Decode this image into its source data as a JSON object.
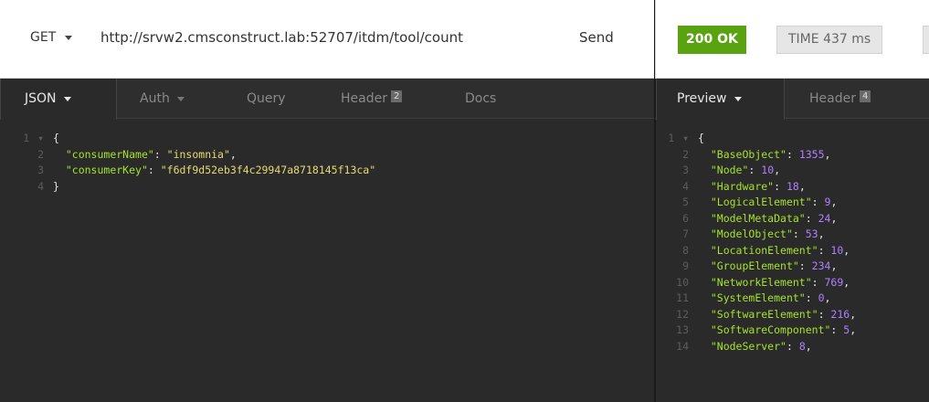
{
  "request": {
    "method": "GET",
    "url": "http://srvw2.cmsconstruct.lab:52707/itdm/tool/count",
    "send_label": "Send"
  },
  "response": {
    "status": "200 OK",
    "time_label": "TIME",
    "time_value": "437 ms"
  },
  "left_tabs": [
    {
      "label": "JSON",
      "active": true
    },
    {
      "label": "Auth"
    },
    {
      "label": "Query"
    },
    {
      "label": "Header",
      "badge": "2"
    },
    {
      "label": "Docs"
    }
  ],
  "right_tabs": [
    {
      "label": "Preview",
      "active": true
    },
    {
      "label": "Header",
      "badge": "4"
    }
  ],
  "request_body": [
    {
      "n": "1",
      "fold": true,
      "text": "{"
    },
    {
      "n": "2",
      "key": "consumerName",
      "str": "insomnia",
      "comma": true
    },
    {
      "n": "3",
      "key": "consumerKey",
      "str": "f6df9d52eb3f4c29947a8718145f13ca"
    },
    {
      "n": "4",
      "text": "}"
    }
  ],
  "response_body": [
    {
      "n": "1",
      "fold": true,
      "text": "{"
    },
    {
      "n": "2",
      "key": "BaseObject",
      "num": "1355"
    },
    {
      "n": "3",
      "key": "Node",
      "num": "10"
    },
    {
      "n": "4",
      "key": "Hardware",
      "num": "18"
    },
    {
      "n": "5",
      "key": "LogicalElement",
      "num": "9"
    },
    {
      "n": "6",
      "key": "ModelMetaData",
      "num": "24"
    },
    {
      "n": "7",
      "key": "ModelObject",
      "num": "53"
    },
    {
      "n": "8",
      "key": "LocationElement",
      "num": "10"
    },
    {
      "n": "9",
      "key": "GroupElement",
      "num": "234"
    },
    {
      "n": "10",
      "key": "NetworkElement",
      "num": "769"
    },
    {
      "n": "11",
      "key": "SystemElement",
      "num": "0"
    },
    {
      "n": "12",
      "key": "SoftwareElement",
      "num": "216"
    },
    {
      "n": "13",
      "key": "SoftwareComponent",
      "num": "5"
    },
    {
      "n": "14",
      "key": "NodeServer",
      "num": "8"
    }
  ],
  "colors": {
    "status_ok": "#59a210",
    "json_key": "#a6e22e",
    "json_string": "#e6db74",
    "json_number": "#ae81ff"
  }
}
